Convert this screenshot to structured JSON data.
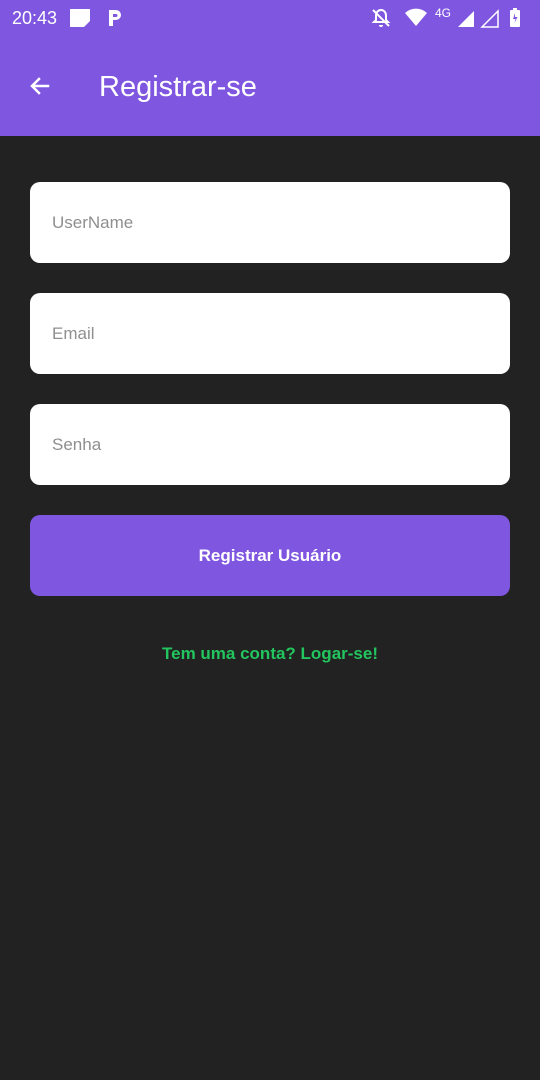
{
  "status_bar": {
    "time": "20:43",
    "network_label": "4G",
    "icons": [
      "note-icon",
      "parking-app-icon",
      "bell-off-icon",
      "wifi-icon",
      "signal-icon",
      "signal-empty-icon",
      "battery-icon"
    ]
  },
  "app_bar": {
    "title": "Registrar-se",
    "back_icon": "arrow-back-icon"
  },
  "form": {
    "username_placeholder": "UserName",
    "email_placeholder": "Email",
    "password_placeholder": "Senha",
    "username_value": "",
    "email_value": "",
    "password_value": "",
    "submit_label": "Registrar Usuário"
  },
  "login_link": "Tem uma conta? Logar-se!",
  "colors": {
    "primary": "#7f56e0",
    "background": "#222222",
    "link": "#22c55e"
  }
}
